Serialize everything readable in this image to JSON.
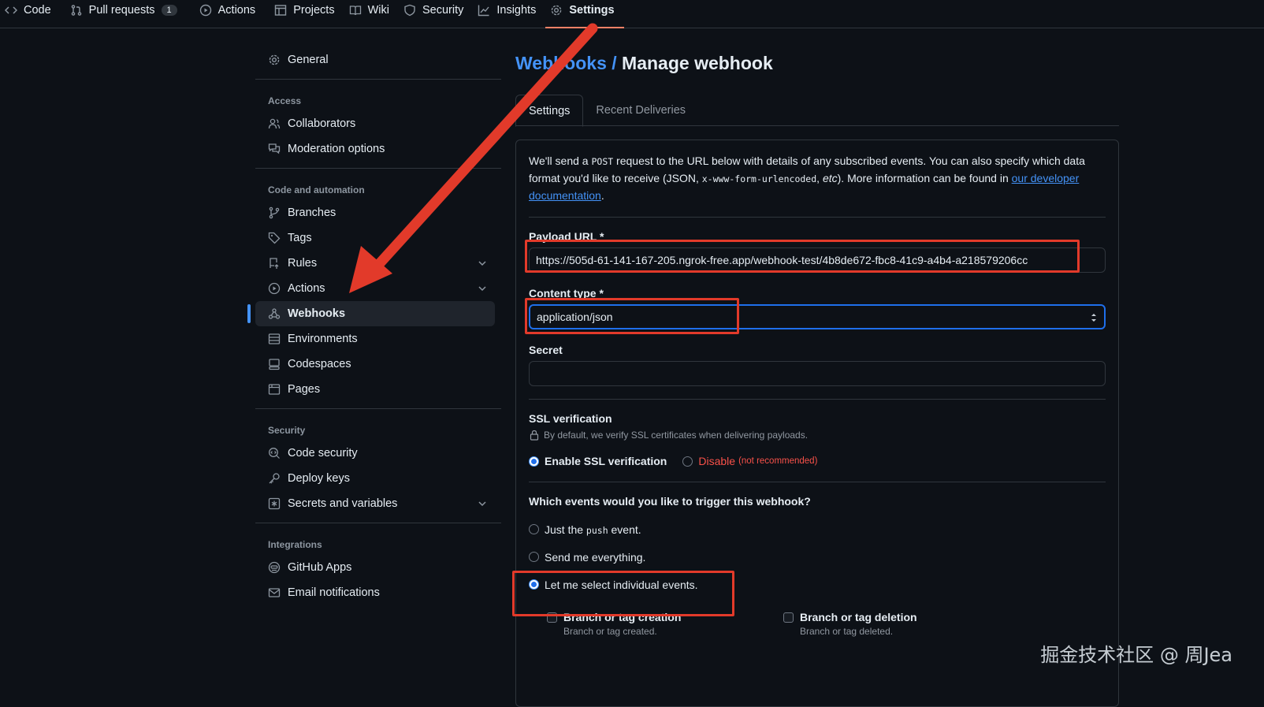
{
  "topnav": {
    "tabs": [
      {
        "label": "Code",
        "icon": "code-icon"
      },
      {
        "label": "Pull requests",
        "icon": "git-pull-request-icon",
        "count": "1"
      },
      {
        "label": "Actions",
        "icon": "play-icon"
      },
      {
        "label": "Projects",
        "icon": "table-icon"
      },
      {
        "label": "Wiki",
        "icon": "book-icon"
      },
      {
        "label": "Security",
        "icon": "shield-icon"
      },
      {
        "label": "Insights",
        "icon": "graph-icon"
      },
      {
        "label": "Settings",
        "icon": "gear-icon",
        "selected": true
      }
    ]
  },
  "sidebar": {
    "general": "General",
    "access_heading": "Access",
    "access": [
      "Collaborators",
      "Moderation options"
    ],
    "code_heading": "Code and automation",
    "code": [
      "Branches",
      "Tags",
      "Rules",
      "Actions",
      "Webhooks",
      "Environments",
      "Codespaces",
      "Pages"
    ],
    "security_heading": "Security",
    "security": [
      "Code security",
      "Deploy keys",
      "Secrets and variables"
    ],
    "integrations_heading": "Integrations",
    "integrations": [
      "GitHub Apps",
      "Email notifications"
    ]
  },
  "main": {
    "crumb": "Webhooks /",
    "title": "Manage webhook",
    "tabs": [
      "Settings",
      "Recent Deliveries"
    ],
    "intro": {
      "p1": "We'll send a ",
      "post": "POST",
      "p2": " request to the URL below with details of any subscribed events. You can also specify which data format you'd like to receive (JSON, ",
      "urlencoded": "x-www-form-urlencoded",
      "p3": ", ",
      "etc": "etc",
      "p4": "). More information can be found in ",
      "link": "our developer documentation",
      "p5": "."
    },
    "payload_label": "Payload URL *",
    "payload_value": "https://505d-61-141-167-205.ngrok-free.app/webhook-test/4b8de672-fbc8-41c9-a4b4-a218579206cc",
    "content_label": "Content type *",
    "content_value": "application/json",
    "secret_label": "Secret",
    "secret_value": "",
    "ssl": {
      "heading": "SSL verification",
      "note": "By default, we verify SSL certificates when delivering payloads.",
      "enable": "Enable SSL verification",
      "disable": "Disable",
      "not_recommended": "(not recommended)"
    },
    "events": {
      "question": "Which events would you like to trigger this webhook?",
      "just_pre": "Just the ",
      "just_code": "push",
      "just_post": " event.",
      "everything": "Send me everything.",
      "individual": "Let me select individual events.",
      "items": [
        {
          "title": "Branch or tag creation",
          "desc": "Branch or tag created."
        },
        {
          "title": "Branch or tag deletion",
          "desc": "Branch or tag deleted."
        }
      ]
    }
  },
  "watermark": "掘金技术社区 @ 周Jea",
  "colors": {
    "accent": "#4493f8",
    "annotation": "#e23a2a",
    "bg": "#0d1117",
    "danger": "#f85149"
  }
}
